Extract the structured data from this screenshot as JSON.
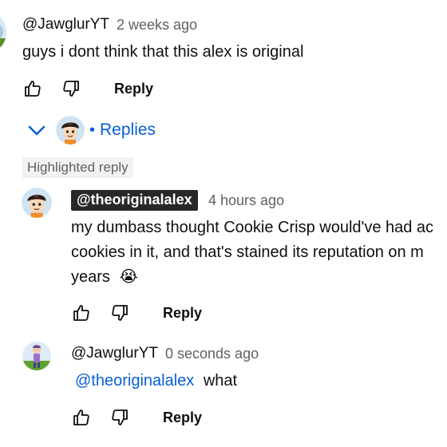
{
  "top_comment": {
    "author": "@JawglurYT",
    "time": "2 weeks ago",
    "text": "guys i dont think that this alex is original",
    "reply_label": "Reply"
  },
  "replies_toggle": {
    "label": "Replies",
    "separator": "•",
    "icon": "chevron-down-icon"
  },
  "highlighted_reply": {
    "tag": "Highlighted reply",
    "author": "@theoriginalalex",
    "time": "4 hours ago",
    "line1": "my dumbass thought Cookie Crisp would've had ac",
    "line2": "cookies in it, and that's stained its reputation on m",
    "line3": "years",
    "emoji": "😭",
    "reply_label": "Reply"
  },
  "user_reply": {
    "author": "@JawglurYT",
    "time": "0 seconds ago",
    "mention": "@theoriginalalex",
    "text": "what",
    "reply_label": "Reply"
  },
  "colors": {
    "link_blue": "#065fd4",
    "secondary_text": "#606060",
    "badge_bg": "#282828"
  }
}
